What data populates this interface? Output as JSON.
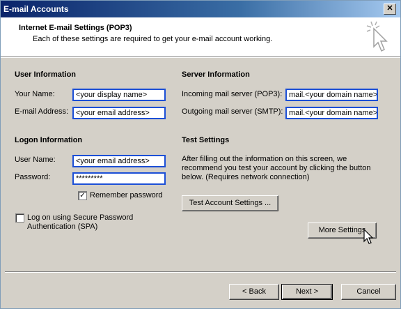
{
  "window": {
    "title": "E-mail Accounts",
    "close_glyph": "✕"
  },
  "header": {
    "title": "Internet E-mail Settings (POP3)",
    "subtitle": "Each of these settings are required to get your e-mail account working."
  },
  "user_info": {
    "heading": "User Information",
    "name_label": "Your Name:",
    "name_value": "<your display name>",
    "email_label": "E-mail Address:",
    "email_value": "<your email address>"
  },
  "logon_info": {
    "heading": "Logon Information",
    "user_label": "User Name:",
    "user_value": "<your email address>",
    "password_label": "Password:",
    "password_value": "*********",
    "remember_label": "Remember password",
    "remember_checked": "✓",
    "spa_label_line1": "Log on using Secure Password",
    "spa_label_line2": "Authentication (SPA)"
  },
  "server_info": {
    "heading": "Server Information",
    "incoming_label": "Incoming mail server (POP3):",
    "incoming_value": "mail.<your domain name>",
    "outgoing_label": "Outgoing mail server (SMTP):",
    "outgoing_value": "mail.<your domain name>"
  },
  "test_settings": {
    "heading": "Test Settings",
    "description": "After filling out the information on this screen, we recommend you test your account by clicking the button below. (Requires network connection)",
    "test_button": "Test Account Settings ...",
    "more_button": "More Settings"
  },
  "footer": {
    "back": "< Back",
    "next": "Next >",
    "cancel": "Cancel"
  }
}
